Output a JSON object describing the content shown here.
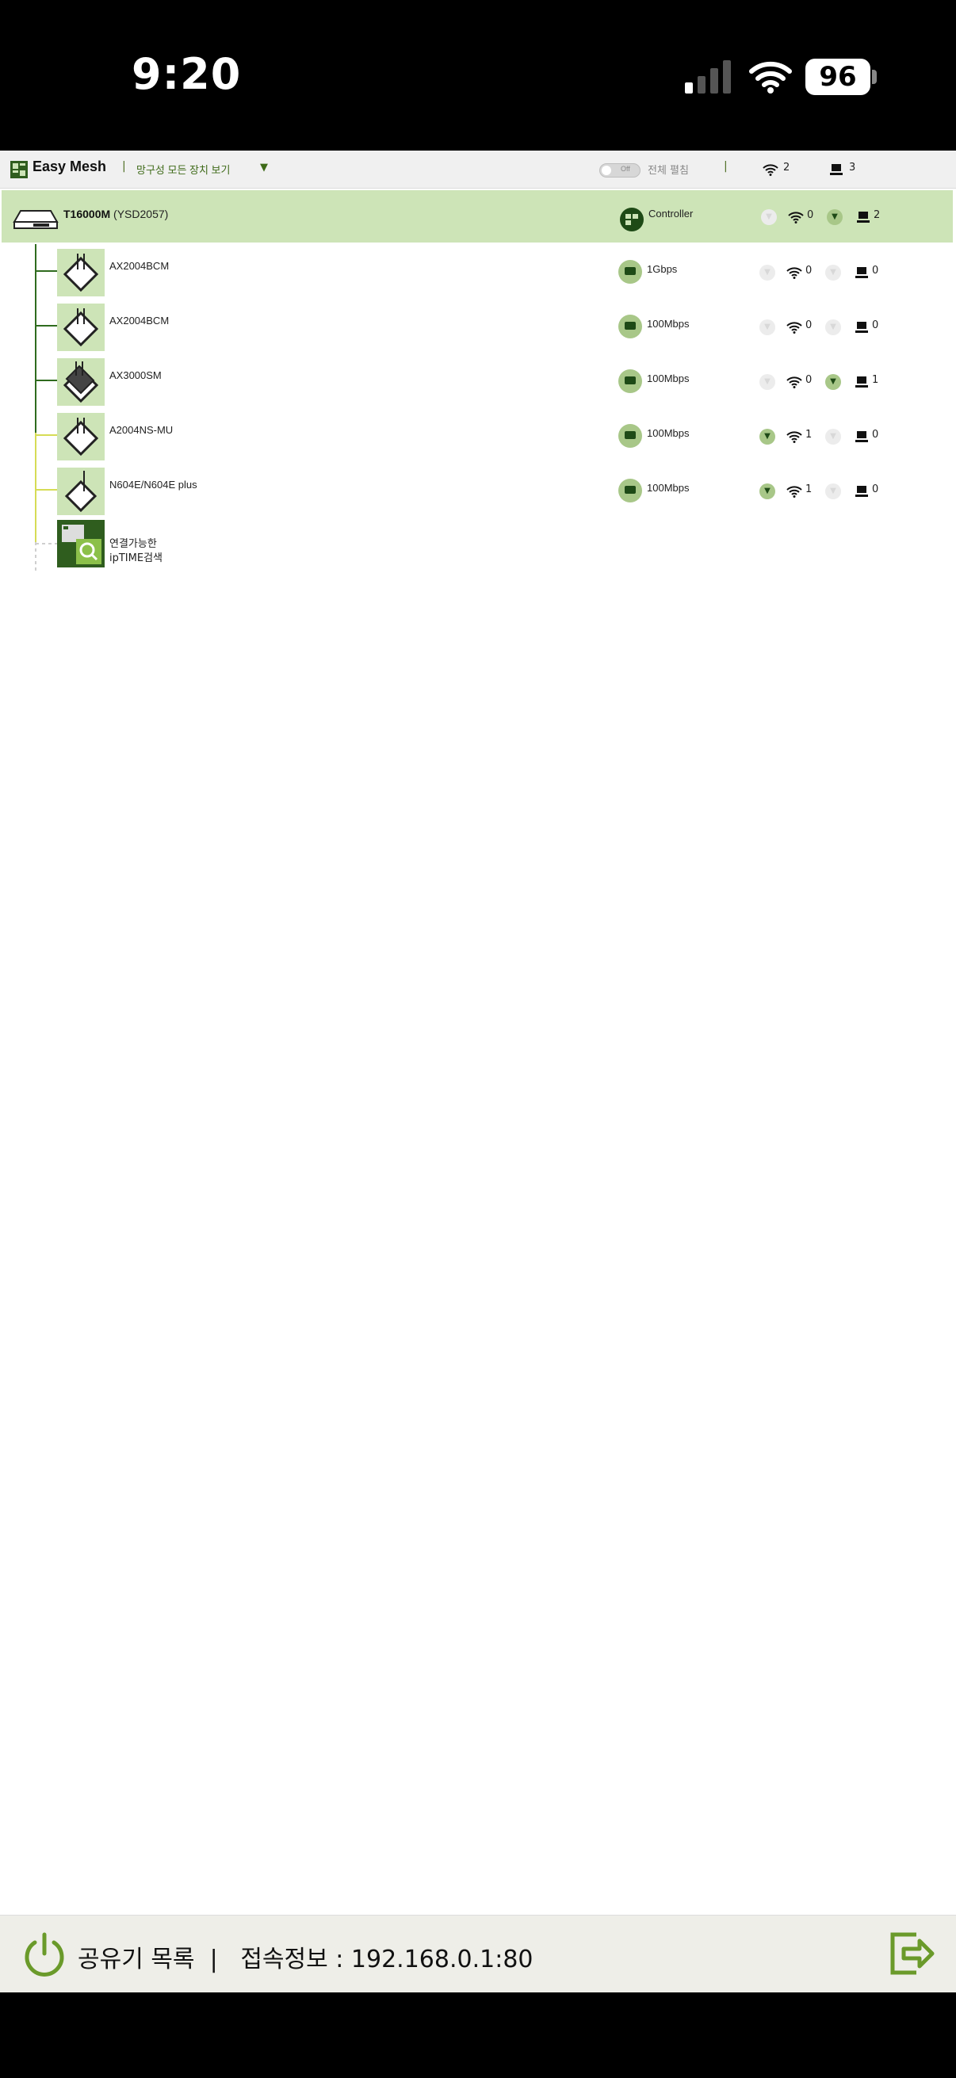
{
  "status_bar": {
    "time": "9:20",
    "battery": "96"
  },
  "header": {
    "app_title": "Easy Mesh",
    "separator": "|",
    "view_select": "망구성 모든 장치 보기",
    "dropdown_arrow": "▼",
    "toggle_text": "Off",
    "expand_label": "전체 펼침",
    "separator2": "|",
    "wifi_count": "2",
    "lan_count": "3"
  },
  "root_device": {
    "model": "T16000M",
    "id": "(YSD2057)",
    "connection": "Controller",
    "wifi_count": "0",
    "lan_count": "2"
  },
  "devices": [
    {
      "name": "AX2004BCM",
      "link": "1Gbps",
      "wifi_count": "0",
      "lan_count": "0"
    },
    {
      "name": "AX2004BCM",
      "link": "100Mbps",
      "wifi_count": "0",
      "lan_count": "0"
    },
    {
      "name": "AX3000SM",
      "link": "100Mbps",
      "wifi_count": "0",
      "lan_count": "1"
    },
    {
      "name": "A2004NS-MU",
      "link": "100Mbps",
      "wifi_count": "1",
      "lan_count": "0"
    },
    {
      "name": "N604E/N604E plus",
      "link": "100Mbps",
      "wifi_count": "1",
      "lan_count": "0"
    }
  ],
  "search": {
    "line1": "연결가능한",
    "line2": "ipTIME검색"
  },
  "bottom_bar": {
    "text": "공유기 목록  |   접속정보 : 192.168.0.1:80"
  },
  "colors": {
    "accent_green": "#3e6a18",
    "row_highlight": "#cde4b7",
    "dark_green": "#1e4a16"
  }
}
